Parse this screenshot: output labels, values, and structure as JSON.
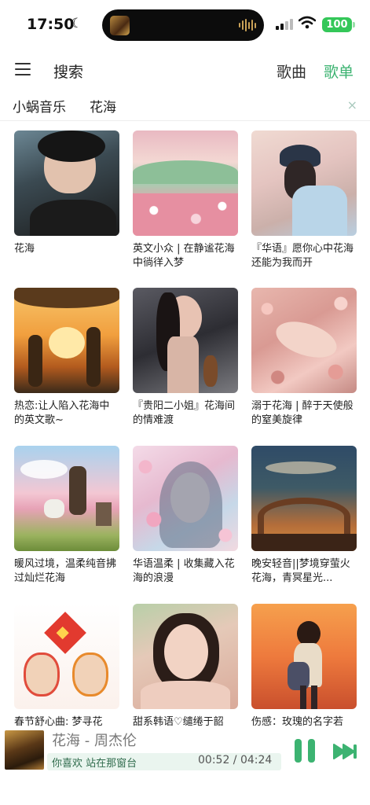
{
  "status_bar": {
    "time": "17:50",
    "battery": "100"
  },
  "header": {
    "search_label": "搜索",
    "tabs": [
      {
        "label": "歌曲",
        "active": false
      },
      {
        "label": "歌单",
        "active": true
      }
    ],
    "active_color": "#3cb371"
  },
  "query": {
    "source": "小蜗音乐",
    "term": "花海",
    "clear_icon": "×"
  },
  "playlists": [
    {
      "title": "花海"
    },
    {
      "title": "英文小众 | 在静谧花海中徜徉入梦"
    },
    {
      "title": "『华语』愿你心中花海 还能为我而开"
    },
    {
      "title": "热恋:让人陷入花海中的英文歌~"
    },
    {
      "title": "『贵阳二小姐』花海间的情难渡"
    },
    {
      "title": "溺于花海 | 醉于天使般的窒美旋律"
    },
    {
      "title": "暖风过境，温柔纯音拂过灿烂花海"
    },
    {
      "title": "华语温柔 | 收集藏入花海的浪漫"
    },
    {
      "title": "晚安轻音||梦境穿萤火花海，青冥星光..."
    },
    {
      "title": "春节舒心曲: 梦寻花"
    },
    {
      "title": "甜系韩语♡缱绻于韶"
    },
    {
      "title": "伤感：玫瑰的名字若"
    }
  ],
  "player": {
    "title": "花海 - 周杰伦",
    "lyric": "你喜欢 站在那窗台",
    "time": "00:52 / 04:24",
    "accent_color": "#3cb371"
  }
}
